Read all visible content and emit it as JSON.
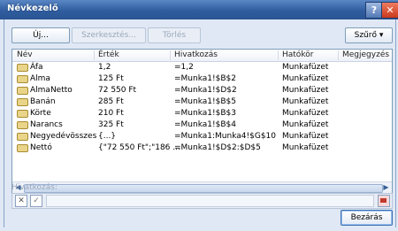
{
  "window": {
    "title": "Névkezelő"
  },
  "controls": {
    "help": "?",
    "close": "✕"
  },
  "toolbar": {
    "new_label": "Új...",
    "edit_label": "Szerkesztés...",
    "delete_label": "Törlés",
    "filter_label": "Szűrő ▾"
  },
  "columns": [
    "Név",
    "Érték",
    "Hivatkozás",
    "Hatókör",
    "Megjegyzés"
  ],
  "rows": [
    {
      "name": "Áfa",
      "value": "1,2",
      "ref": "=1,2",
      "scope": "Munkafüzet"
    },
    {
      "name": "Alma",
      "value": "125 Ft",
      "ref": "=Munka1!$B$2",
      "scope": "Munkafüzet"
    },
    {
      "name": "AlmaNetto",
      "value": "72 550 Ft",
      "ref": "=Munka1!$D$2",
      "scope": "Munkafüzet"
    },
    {
      "name": "Banán",
      "value": "285 Ft",
      "ref": "=Munka1!$B$5",
      "scope": "Munkafüzet"
    },
    {
      "name": "Körte",
      "value": "210 Ft",
      "ref": "=Munka1!$B$3",
      "scope": "Munkafüzet"
    },
    {
      "name": "Narancs",
      "value": "325 Ft",
      "ref": "=Munka1!$B$4",
      "scope": "Munkafüzet"
    },
    {
      "name": "Negyedévösszes",
      "value": "{...}",
      "ref": "=Munka1:Munka4!$G$10",
      "scope": "Munkafüzet"
    },
    {
      "name": "Nettó",
      "value": "{\"72 550 Ft\";\"186 ...",
      "ref": "=Munka1!$D$2:$D$5",
      "scope": "Munkafüzet"
    }
  ],
  "reference": {
    "label": "Hivatkozás:",
    "cancel": "✕",
    "ok": "✓"
  },
  "footer": {
    "close_label": "Bezárás"
  }
}
